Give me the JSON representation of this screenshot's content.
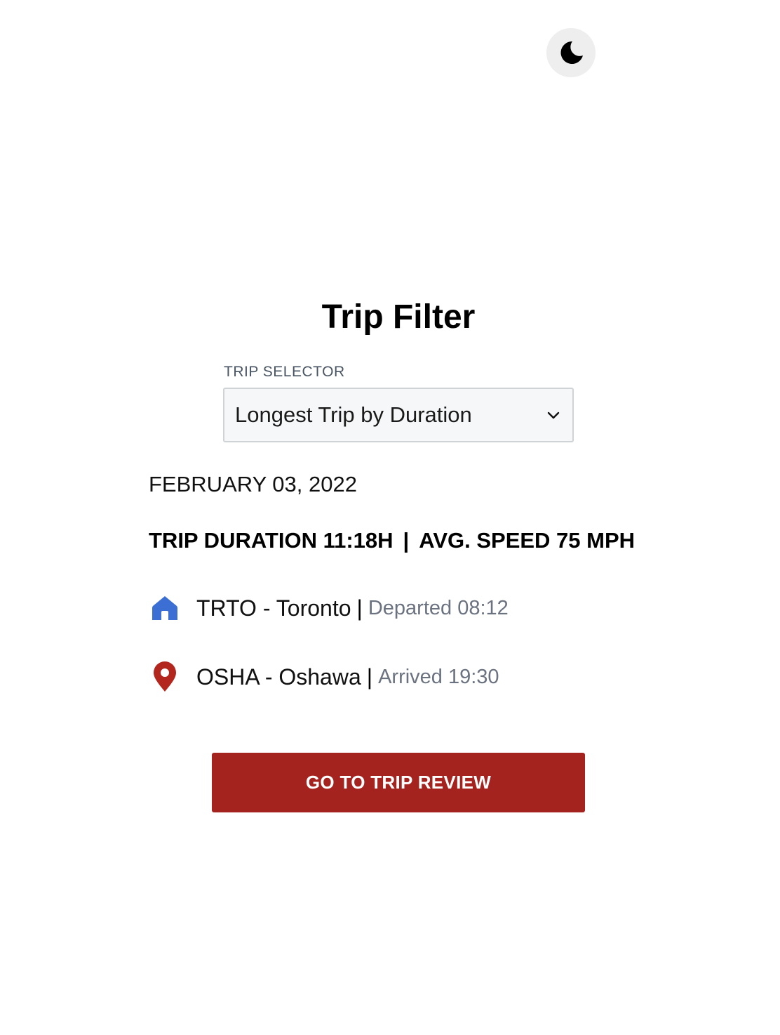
{
  "theme_toggle": {
    "icon": "moon-icon"
  },
  "page_title": "Trip Filter",
  "trip_selector": {
    "label": "TRIP SELECTOR",
    "selected": "Longest Trip by Duration",
    "icon": "chevron-down-icon"
  },
  "trip": {
    "date": "FEBRUARY 03, 2022",
    "duration": "TRIP DURATION 11:18H",
    "separator": "|",
    "avg_speed": "AVG. SPEED 75 MPH",
    "departure": {
      "icon": "home-icon",
      "place": "TRTO - Toronto",
      "separator": "|",
      "time": "Departed 08:12",
      "color": "#3b6fd4"
    },
    "arrival": {
      "icon": "map-pin-icon",
      "place": "OSHA - Oshawa",
      "separator": "|",
      "time": "Arrived 19:30",
      "color": "#b3261e"
    }
  },
  "review_button": {
    "label": "GO TO TRIP REVIEW",
    "color": "#a5231e"
  }
}
